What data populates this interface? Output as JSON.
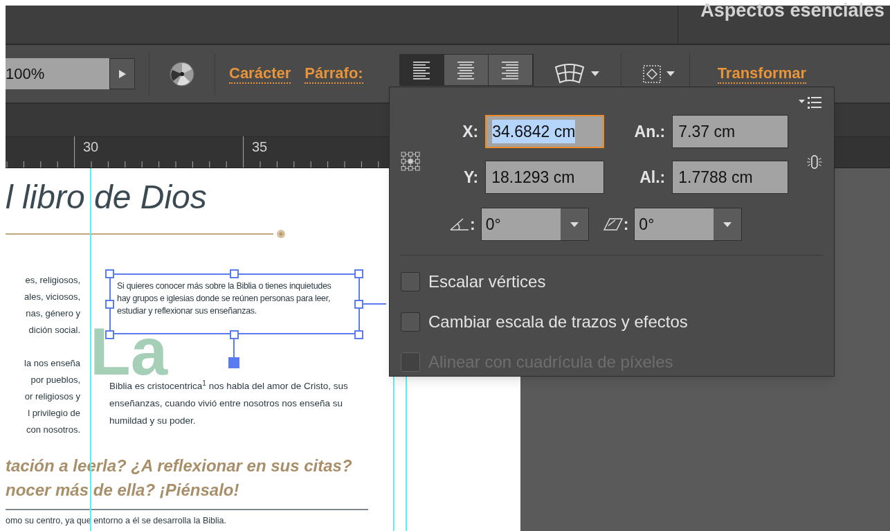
{
  "workspace": {
    "label": "Aspectos esenciales"
  },
  "control_bar": {
    "zoom": {
      "value": "100%"
    },
    "links": [
      {
        "label": "Carácter"
      },
      {
        "label": "Párrafo:"
      }
    ],
    "align_buttons": [
      {
        "kind": "left",
        "selected": true
      },
      {
        "kind": "center",
        "selected": false
      },
      {
        "kind": "right",
        "selected": false
      }
    ],
    "transform_link": {
      "label": "Transformar"
    }
  },
  "ruler": {
    "ticks": [
      "30",
      "35"
    ]
  },
  "document": {
    "title": "l libro de Dios",
    "left_paragraphs": [
      [
        "es, religiosos,",
        "ales, viciosos,",
        "nas, género y",
        "dición social."
      ],
      [
        "la nos enseña",
        "por pueblos,",
        "or religiosos y",
        "l privilegio de",
        "con nosotros."
      ]
    ],
    "selected_frame": {
      "text": "Si quieres conocer más sobre la Biblia o tienes inquietudes hay grupos e iglesias donde se reúnen personas para leer, estudiar y reflexionar sus enseñanzas.",
      "selected": true
    },
    "drop_cap": "La",
    "body": "Biblia es cristocentrica$^{1}$ nos habla del amor de Cristo, sus enseñanzas, cuando vivió entre nosotros nos enseña su humildad y su poder.",
    "heading_lines": [
      "tación a leerla? ¿A reflexionar en sus citas?",
      "nocer más de ella? ¡Piénsalo!"
    ],
    "footer": "omo su centro, ya que entorno a él se desarrolla la Biblia."
  },
  "transform_panel": {
    "fields": [
      {
        "label": "X:",
        "value": "34.6842 cm",
        "focused": true
      },
      {
        "label": "An.:",
        "value": "7.37 cm",
        "focused": false
      },
      {
        "label": "Y:",
        "value": "18.1293 cm",
        "focused": false
      },
      {
        "label": "Al.:",
        "value": "1.7788 cm",
        "focused": false
      }
    ],
    "angle_fields": [
      {
        "kind": "rotate",
        "label": ":",
        "value": "0°"
      },
      {
        "kind": "shear",
        "label": ":",
        "value": "0°"
      }
    ],
    "options": [
      {
        "label": "Escalar vértices",
        "checked": false,
        "disabled": false
      },
      {
        "label": "Cambiar escala de trazos y efectos",
        "checked": false,
        "disabled": false
      },
      {
        "label": "Alinear con cuadrícula de píxeles",
        "checked": false,
        "disabled": true
      }
    ]
  }
}
